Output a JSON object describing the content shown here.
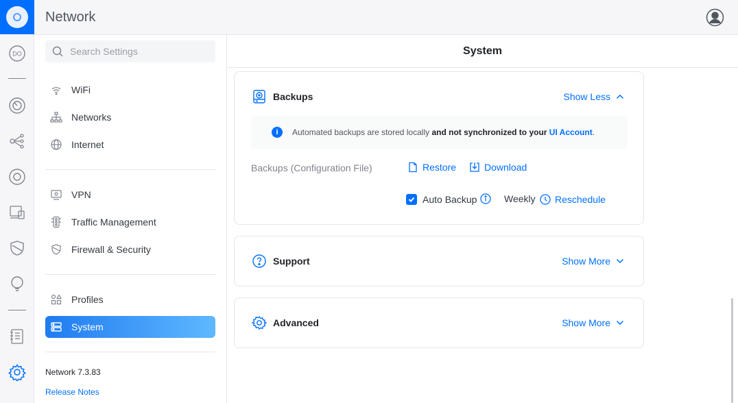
{
  "app": {
    "title": "Network"
  },
  "rail": {
    "icons": [
      "unifi-logo-icon",
      "dashboard-icon",
      "topology-icon",
      "devices-icon",
      "clients-icon",
      "client-devices-icon",
      "security-icon",
      "insights-icon",
      "logs-icon",
      "settings-icon"
    ],
    "dashboard_badge": "DO"
  },
  "search": {
    "placeholder": "Search Settings"
  },
  "nav": {
    "items": [
      {
        "label": "WiFi",
        "icon": "wifi-icon"
      },
      {
        "label": "Networks",
        "icon": "networks-icon"
      },
      {
        "label": "Internet",
        "icon": "globe-icon"
      },
      {
        "label": "VPN",
        "icon": "vpn-icon"
      },
      {
        "label": "Traffic Management",
        "icon": "traffic-icon"
      },
      {
        "label": "Firewall & Security",
        "icon": "shield-icon"
      },
      {
        "label": "Profiles",
        "icon": "profiles-icon"
      },
      {
        "label": "System",
        "icon": "system-icon",
        "active": true
      }
    ],
    "version": "Network 7.3.83",
    "release_notes": "Release Notes"
  },
  "main": {
    "title": "System",
    "backups": {
      "title": "Backups",
      "toggle": "Show Less",
      "notice_prefix": "Automated backups are stored locally ",
      "notice_bold": "and not synchronized to your ",
      "notice_link": "UI Account",
      "notice_suffix": ".",
      "row_label": "Backups (Configuration File)",
      "restore": "Restore",
      "download": "Download",
      "auto_backup": "Auto Backup",
      "auto_backup_checked": true,
      "frequency": "Weekly",
      "reschedule": "Reschedule"
    },
    "support": {
      "title": "Support",
      "toggle": "Show More"
    },
    "advanced": {
      "title": "Advanced",
      "toggle": "Show More"
    }
  },
  "colors": {
    "accent": "#006fff",
    "rail_bg": "#f6f6f8",
    "text": "#212327",
    "muted": "#80848d"
  }
}
